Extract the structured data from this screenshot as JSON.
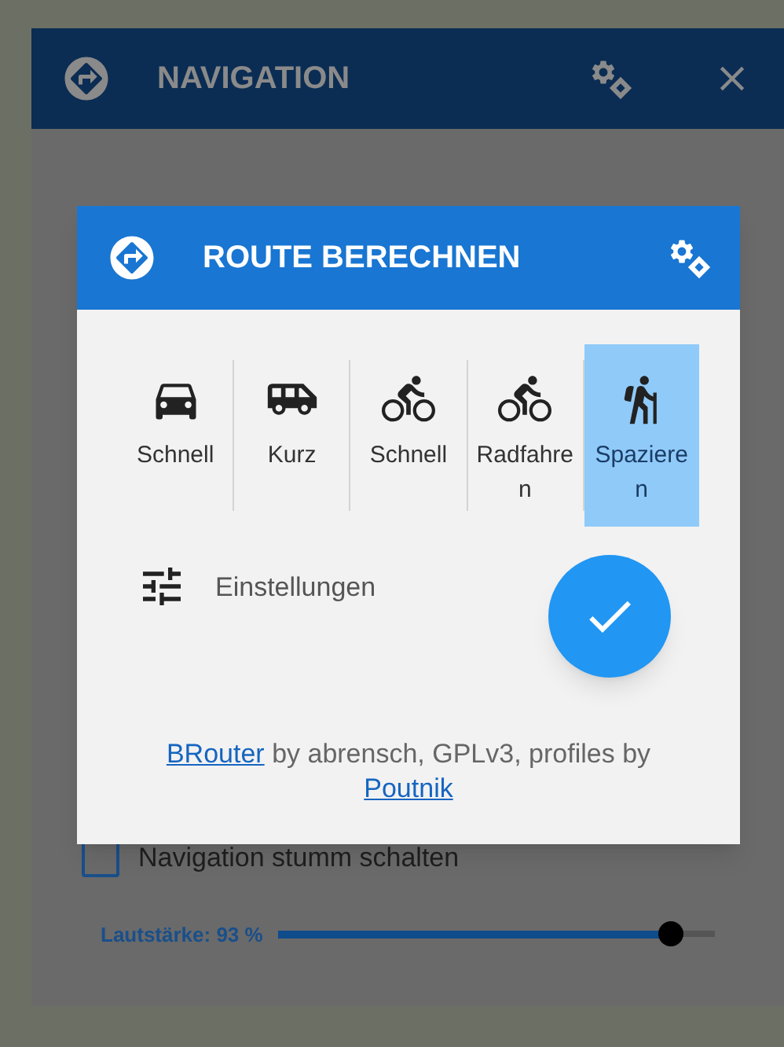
{
  "back_dialog": {
    "title": "NAVIGATION",
    "mute": {
      "label": "Navigation stumm schalten",
      "checked": false
    },
    "volume": {
      "label": "Lautstärke: 93 %",
      "level": 0.9
    }
  },
  "dialog": {
    "title": "ROUTE BERECHNEN",
    "profiles": [
      {
        "kind": "car",
        "label": "Schnell",
        "selected": false
      },
      {
        "kind": "van",
        "label": "Kurz",
        "selected": false
      },
      {
        "kind": "bike",
        "label": "Schnell",
        "selected": false
      },
      {
        "kind": "bike",
        "label": "Radfahren",
        "selected": false
      },
      {
        "kind": "hiking",
        "label": "Spazieren",
        "selected": true
      }
    ],
    "settings_label": "Einstellungen",
    "credit": {
      "link1": "BRouter",
      "text": "by abrensch, GPLv3, profiles by",
      "link2": "Poutnik"
    }
  }
}
